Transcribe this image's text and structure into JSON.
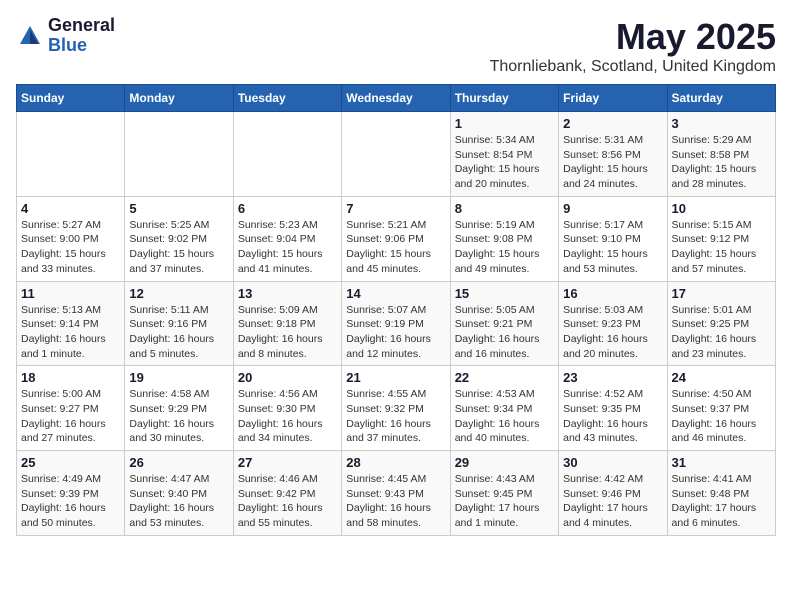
{
  "header": {
    "logo_general": "General",
    "logo_blue": "Blue",
    "title": "May 2025",
    "subtitle": "Thornliebank, Scotland, United Kingdom"
  },
  "days_of_week": [
    "Sunday",
    "Monday",
    "Tuesday",
    "Wednesday",
    "Thursday",
    "Friday",
    "Saturday"
  ],
  "weeks": [
    [
      {
        "day": "",
        "info": ""
      },
      {
        "day": "",
        "info": ""
      },
      {
        "day": "",
        "info": ""
      },
      {
        "day": "",
        "info": ""
      },
      {
        "day": "1",
        "info": "Sunrise: 5:34 AM\nSunset: 8:54 PM\nDaylight: 15 hours\nand 20 minutes."
      },
      {
        "day": "2",
        "info": "Sunrise: 5:31 AM\nSunset: 8:56 PM\nDaylight: 15 hours\nand 24 minutes."
      },
      {
        "day": "3",
        "info": "Sunrise: 5:29 AM\nSunset: 8:58 PM\nDaylight: 15 hours\nand 28 minutes."
      }
    ],
    [
      {
        "day": "4",
        "info": "Sunrise: 5:27 AM\nSunset: 9:00 PM\nDaylight: 15 hours\nand 33 minutes."
      },
      {
        "day": "5",
        "info": "Sunrise: 5:25 AM\nSunset: 9:02 PM\nDaylight: 15 hours\nand 37 minutes."
      },
      {
        "day": "6",
        "info": "Sunrise: 5:23 AM\nSunset: 9:04 PM\nDaylight: 15 hours\nand 41 minutes."
      },
      {
        "day": "7",
        "info": "Sunrise: 5:21 AM\nSunset: 9:06 PM\nDaylight: 15 hours\nand 45 minutes."
      },
      {
        "day": "8",
        "info": "Sunrise: 5:19 AM\nSunset: 9:08 PM\nDaylight: 15 hours\nand 49 minutes."
      },
      {
        "day": "9",
        "info": "Sunrise: 5:17 AM\nSunset: 9:10 PM\nDaylight: 15 hours\nand 53 minutes."
      },
      {
        "day": "10",
        "info": "Sunrise: 5:15 AM\nSunset: 9:12 PM\nDaylight: 15 hours\nand 57 minutes."
      }
    ],
    [
      {
        "day": "11",
        "info": "Sunrise: 5:13 AM\nSunset: 9:14 PM\nDaylight: 16 hours\nand 1 minute."
      },
      {
        "day": "12",
        "info": "Sunrise: 5:11 AM\nSunset: 9:16 PM\nDaylight: 16 hours\nand 5 minutes."
      },
      {
        "day": "13",
        "info": "Sunrise: 5:09 AM\nSunset: 9:18 PM\nDaylight: 16 hours\nand 8 minutes."
      },
      {
        "day": "14",
        "info": "Sunrise: 5:07 AM\nSunset: 9:19 PM\nDaylight: 16 hours\nand 12 minutes."
      },
      {
        "day": "15",
        "info": "Sunrise: 5:05 AM\nSunset: 9:21 PM\nDaylight: 16 hours\nand 16 minutes."
      },
      {
        "day": "16",
        "info": "Sunrise: 5:03 AM\nSunset: 9:23 PM\nDaylight: 16 hours\nand 20 minutes."
      },
      {
        "day": "17",
        "info": "Sunrise: 5:01 AM\nSunset: 9:25 PM\nDaylight: 16 hours\nand 23 minutes."
      }
    ],
    [
      {
        "day": "18",
        "info": "Sunrise: 5:00 AM\nSunset: 9:27 PM\nDaylight: 16 hours\nand 27 minutes."
      },
      {
        "day": "19",
        "info": "Sunrise: 4:58 AM\nSunset: 9:29 PM\nDaylight: 16 hours\nand 30 minutes."
      },
      {
        "day": "20",
        "info": "Sunrise: 4:56 AM\nSunset: 9:30 PM\nDaylight: 16 hours\nand 34 minutes."
      },
      {
        "day": "21",
        "info": "Sunrise: 4:55 AM\nSunset: 9:32 PM\nDaylight: 16 hours\nand 37 minutes."
      },
      {
        "day": "22",
        "info": "Sunrise: 4:53 AM\nSunset: 9:34 PM\nDaylight: 16 hours\nand 40 minutes."
      },
      {
        "day": "23",
        "info": "Sunrise: 4:52 AM\nSunset: 9:35 PM\nDaylight: 16 hours\nand 43 minutes."
      },
      {
        "day": "24",
        "info": "Sunrise: 4:50 AM\nSunset: 9:37 PM\nDaylight: 16 hours\nand 46 minutes."
      }
    ],
    [
      {
        "day": "25",
        "info": "Sunrise: 4:49 AM\nSunset: 9:39 PM\nDaylight: 16 hours\nand 50 minutes."
      },
      {
        "day": "26",
        "info": "Sunrise: 4:47 AM\nSunset: 9:40 PM\nDaylight: 16 hours\nand 53 minutes."
      },
      {
        "day": "27",
        "info": "Sunrise: 4:46 AM\nSunset: 9:42 PM\nDaylight: 16 hours\nand 55 minutes."
      },
      {
        "day": "28",
        "info": "Sunrise: 4:45 AM\nSunset: 9:43 PM\nDaylight: 16 hours\nand 58 minutes."
      },
      {
        "day": "29",
        "info": "Sunrise: 4:43 AM\nSunset: 9:45 PM\nDaylight: 17 hours\nand 1 minute."
      },
      {
        "day": "30",
        "info": "Sunrise: 4:42 AM\nSunset: 9:46 PM\nDaylight: 17 hours\nand 4 minutes."
      },
      {
        "day": "31",
        "info": "Sunrise: 4:41 AM\nSunset: 9:48 PM\nDaylight: 17 hours\nand 6 minutes."
      }
    ]
  ]
}
